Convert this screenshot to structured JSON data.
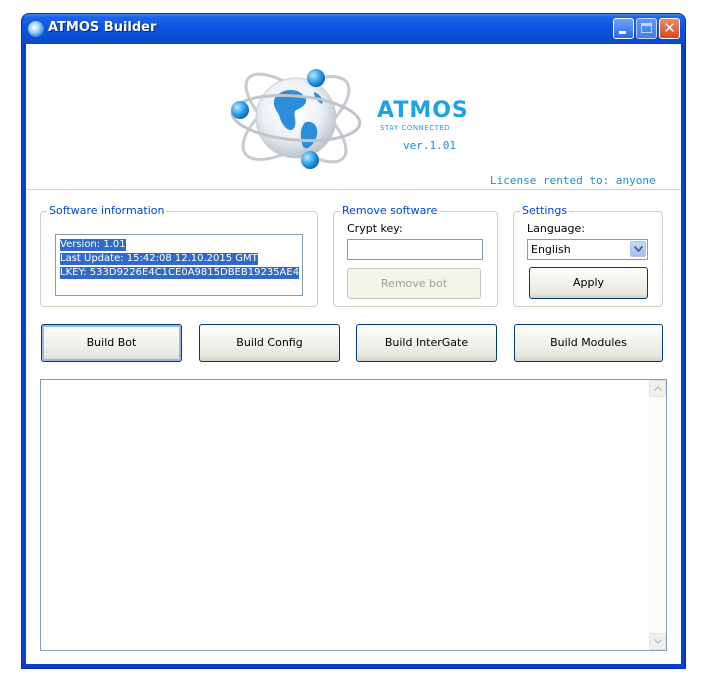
{
  "window": {
    "title": "ATMOS Builder"
  },
  "header": {
    "brand": "ATMOS",
    "slogan": "STAY CONNECTED",
    "version": "ver.1.01",
    "license": "License rented to: anyone"
  },
  "software_info": {
    "legend": "Software information",
    "lines": [
      "Version: 1.01",
      "Last Update: 15:42:08 12.10.2015 GMT",
      "LKEY: 533D9226E4C1CE0A9815DBEB19235AE4"
    ]
  },
  "remove_software": {
    "legend": "Remove software",
    "crypt_key_label": "Crypt key:",
    "crypt_key_value": "",
    "remove_button": "Remove bot"
  },
  "settings": {
    "legend": "Settings",
    "language_label": "Language:",
    "language_selected": "English",
    "apply_button": "Apply"
  },
  "actions": {
    "build_bot": "Build Bot",
    "build_config": "Build Config",
    "build_intergate": "Build InterGate",
    "build_modules": "Build Modules"
  },
  "log": {
    "content": ""
  },
  "icons": [
    "app-globe-icon",
    "minimize-icon",
    "maximize-icon",
    "close-icon",
    "globe-logo-icon",
    "chevron-down-icon",
    "scroll-up-icon",
    "scroll-down-icon"
  ],
  "colors": {
    "titlebar": "#0a55e0",
    "brand": "#1ba3e6",
    "legend": "#0046d5",
    "selection": "#316ac5"
  }
}
